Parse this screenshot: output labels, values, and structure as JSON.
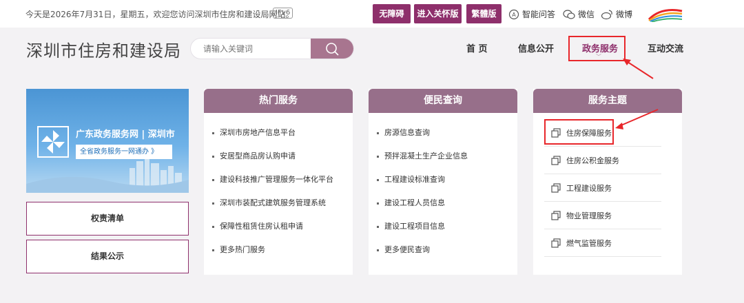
{
  "topbar": {
    "greeting": "今天是2026年7月31日，星期五，欢迎您访问深圳市住房和建设局网站。",
    "ipv6": "IPv6",
    "buttons": [
      "无障碍",
      "进入关怀版",
      "繁體版"
    ],
    "links": [
      "智能问答",
      "微信",
      "微博"
    ],
    "accent_color": "#8e2f6b"
  },
  "header": {
    "title": "深圳市住房和建设局",
    "search_placeholder": "请输入关键词",
    "nav": [
      "首 页",
      "信息公开",
      "政务服务",
      "互动交流"
    ]
  },
  "left": {
    "banner_title": "广东政务服务网 | 深圳市",
    "banner_sub": "全省政务服务一网通办 》",
    "boxes": [
      "权责清单",
      "结果公示"
    ]
  },
  "cards": {
    "hot": {
      "title": "热门服务",
      "items": [
        "深圳市房地产信息平台",
        "安居型商品房认购申请",
        "建设科技推广管理服务一体化平台",
        "深圳市装配式建筑服务管理系统",
        "保障性租赁住房认租申请",
        "更多热门服务"
      ]
    },
    "query": {
      "title": "便民查询",
      "items": [
        "房源信息查询",
        "预拌混凝土生产企业信息",
        "工程建设标准查询",
        "建设工程人员信息",
        "建设工程项目信息",
        "更多便民查询"
      ]
    },
    "theme": {
      "title": "服务主题",
      "items": [
        "住房保障服务",
        "住房公积金服务",
        "工程建设服务",
        "物业管理服务",
        "燃气监管服务"
      ]
    }
  }
}
